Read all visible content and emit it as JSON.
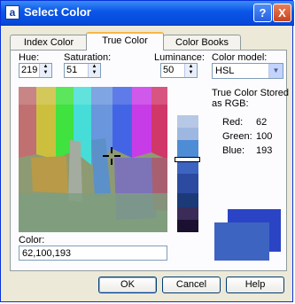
{
  "title": "Select Color",
  "title_buttons": {
    "help": "?",
    "close": "X"
  },
  "tabs": [
    {
      "label": "Index Color",
      "active": false
    },
    {
      "label": "True Color",
      "active": true
    },
    {
      "label": "Color Books",
      "active": false
    }
  ],
  "hue": {
    "label": "Hue:",
    "value": "219"
  },
  "saturation": {
    "label": "Saturation:",
    "value": "51"
  },
  "luminance": {
    "label": "Luminance:",
    "value": "50"
  },
  "color_model": {
    "label": "Color model:",
    "value": "HSL"
  },
  "rgb_info": {
    "caption_line1": "True Color Stored",
    "caption_line2": "as RGB:",
    "red_label": "Red:",
    "red_value": "62",
    "green_label": "Green:",
    "green_value": "100",
    "blue_label": "Blue:",
    "blue_value": "193"
  },
  "color": {
    "label": "Color:",
    "value": "62,100,193"
  },
  "buttons": {
    "ok": "OK",
    "cancel": "Cancel",
    "help": "Help"
  },
  "colors": {
    "current": "#3e64c1",
    "previous": "#2b44c6"
  }
}
